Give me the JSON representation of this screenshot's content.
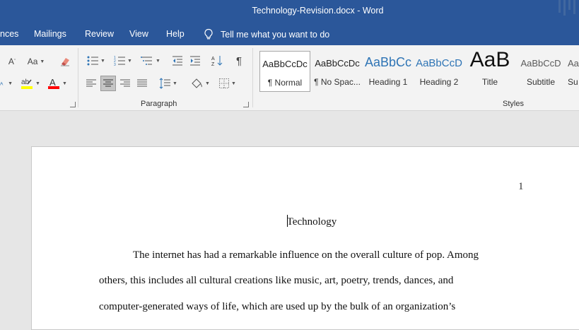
{
  "window": {
    "title": "Technology-Revision.docx  -  Word"
  },
  "tabs": [
    "nces",
    "Mailings",
    "Review",
    "View",
    "Help"
  ],
  "tell_me": "Tell me what you want to do",
  "ribbon": {
    "font_group": {
      "font_size_btn": "A",
      "change_case": "Aa"
    },
    "paragraph_label": "Paragraph",
    "styles_label": "Styles",
    "styles": [
      {
        "sample": "AaBbCcDc",
        "name": "¶ Normal",
        "active": true,
        "color": "#222222"
      },
      {
        "sample": "AaBbCcDc",
        "name": "¶ No Spac...",
        "active": false,
        "color": "#222222"
      },
      {
        "sample": "AaBbCc",
        "name": "Heading 1",
        "active": false,
        "color": "#2e74b5"
      },
      {
        "sample": "AaBbCcD",
        "name": "Heading 2",
        "active": false,
        "color": "#2e74b5"
      },
      {
        "sample": "AaB",
        "name": "Title",
        "active": false,
        "color": "#222222"
      },
      {
        "sample": "AaBbCcD",
        "name": "Subtitle",
        "active": false,
        "color": "#5a5a5a"
      },
      {
        "sample": "Aa",
        "name": "Su",
        "active": false,
        "color": "#5a5a5a"
      }
    ]
  },
  "document": {
    "page_number": "1",
    "title": "Technology",
    "lines": [
      "The internet has had a remarkable influence on the overall culture of pop. Among",
      "others, this includes all cultural creations like music, art, poetry, trends, dances, and",
      "computer-generated ways of life, which are used up by the bulk of an organization’s"
    ]
  },
  "colors": {
    "brand": "#2b579a",
    "heading": "#2e74b5",
    "highlight": "#ffff00",
    "font_color": "#ff0000"
  }
}
